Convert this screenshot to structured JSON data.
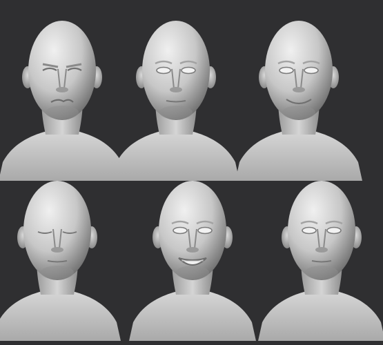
{
  "scene": {
    "background": "#2f2f31",
    "clay_light": "#e9e9e9",
    "clay_mid": "#b7b7b7",
    "clay_dark": "#6a6a6a"
  },
  "busts": [
    {
      "id": "bust-1",
      "expression": "disgust"
    },
    {
      "id": "bust-2",
      "expression": "neutral"
    },
    {
      "id": "bust-3",
      "expression": "smile"
    },
    {
      "id": "bust-4",
      "expression": "eyes-closed"
    },
    {
      "id": "bust-5",
      "expression": "wide-grin"
    },
    {
      "id": "bust-6",
      "expression": "neutral"
    }
  ]
}
